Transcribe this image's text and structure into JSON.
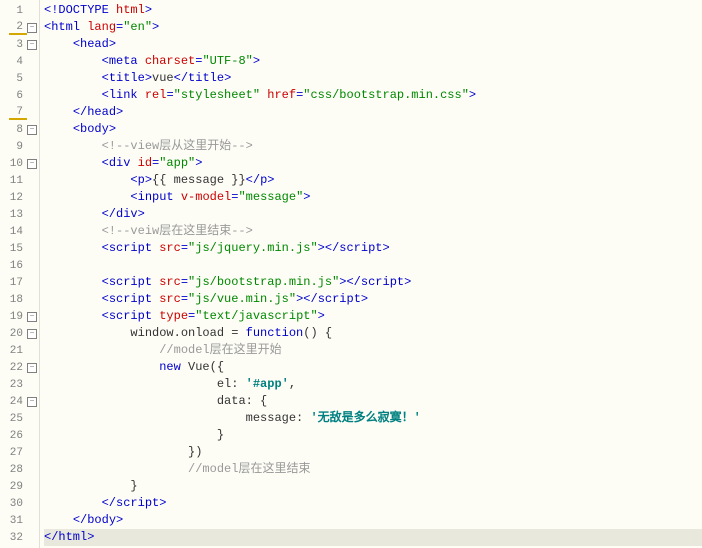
{
  "lines": [
    {
      "num": 1,
      "fold": "",
      "underline": false,
      "tokens": [
        {
          "c": "punct",
          "t": "<!"
        },
        {
          "c": "tag",
          "t": "DOCTYPE"
        },
        {
          "c": "text",
          "t": " "
        },
        {
          "c": "attr-name",
          "t": "html"
        },
        {
          "c": "punct",
          "t": ">"
        }
      ]
    },
    {
      "num": 2,
      "fold": "−",
      "underline": true,
      "tokens": [
        {
          "c": "punct",
          "t": "<"
        },
        {
          "c": "tag",
          "t": "html"
        },
        {
          "c": "text",
          "t": " "
        },
        {
          "c": "attr-name",
          "t": "lang"
        },
        {
          "c": "punct",
          "t": "="
        },
        {
          "c": "attr-val",
          "t": "\"en\""
        },
        {
          "c": "punct",
          "t": ">"
        }
      ]
    },
    {
      "num": 3,
      "fold": "−",
      "underline": false,
      "indent": 1,
      "tokens": [
        {
          "c": "punct",
          "t": "<"
        },
        {
          "c": "tag",
          "t": "head"
        },
        {
          "c": "punct",
          "t": ">"
        }
      ]
    },
    {
      "num": 4,
      "fold": "",
      "underline": false,
      "indent": 2,
      "tokens": [
        {
          "c": "punct",
          "t": "<"
        },
        {
          "c": "tag",
          "t": "meta"
        },
        {
          "c": "text",
          "t": " "
        },
        {
          "c": "attr-name",
          "t": "charset"
        },
        {
          "c": "punct",
          "t": "="
        },
        {
          "c": "attr-val",
          "t": "\"UTF-8\""
        },
        {
          "c": "punct",
          "t": ">"
        }
      ]
    },
    {
      "num": 5,
      "fold": "",
      "underline": false,
      "indent": 2,
      "tokens": [
        {
          "c": "punct",
          "t": "<"
        },
        {
          "c": "tag",
          "t": "title"
        },
        {
          "c": "punct",
          "t": ">"
        },
        {
          "c": "text",
          "t": "vue"
        },
        {
          "c": "punct",
          "t": "</"
        },
        {
          "c": "tag",
          "t": "title"
        },
        {
          "c": "punct",
          "t": ">"
        }
      ]
    },
    {
      "num": 6,
      "fold": "",
      "underline": false,
      "indent": 2,
      "tokens": [
        {
          "c": "punct",
          "t": "<"
        },
        {
          "c": "tag",
          "t": "link"
        },
        {
          "c": "text",
          "t": " "
        },
        {
          "c": "attr-name",
          "t": "rel"
        },
        {
          "c": "punct",
          "t": "="
        },
        {
          "c": "attr-val",
          "t": "\"stylesheet\""
        },
        {
          "c": "text",
          "t": " "
        },
        {
          "c": "attr-name",
          "t": "href"
        },
        {
          "c": "punct",
          "t": "="
        },
        {
          "c": "attr-val",
          "t": "\"css/bootstrap.min.css\""
        },
        {
          "c": "punct",
          "t": ">"
        }
      ]
    },
    {
      "num": 7,
      "fold": "",
      "underline": true,
      "indent": 1,
      "tokens": [
        {
          "c": "punct",
          "t": "</"
        },
        {
          "c": "tag",
          "t": "head"
        },
        {
          "c": "punct",
          "t": ">"
        }
      ]
    },
    {
      "num": 8,
      "fold": "−",
      "underline": false,
      "indent": 1,
      "tokens": [
        {
          "c": "punct",
          "t": "<"
        },
        {
          "c": "tag",
          "t": "body"
        },
        {
          "c": "punct",
          "t": ">"
        }
      ]
    },
    {
      "num": 9,
      "fold": "",
      "underline": false,
      "indent": 2,
      "tokens": [
        {
          "c": "comment",
          "t": "<!--view层从这里开始-->"
        }
      ]
    },
    {
      "num": 10,
      "fold": "−",
      "underline": false,
      "indent": 2,
      "tokens": [
        {
          "c": "punct",
          "t": "<"
        },
        {
          "c": "tag",
          "t": "div"
        },
        {
          "c": "text",
          "t": " "
        },
        {
          "c": "attr-name",
          "t": "id"
        },
        {
          "c": "punct",
          "t": "="
        },
        {
          "c": "attr-val",
          "t": "\"app\""
        },
        {
          "c": "punct",
          "t": ">"
        }
      ]
    },
    {
      "num": 11,
      "fold": "",
      "underline": false,
      "indent": 3,
      "tokens": [
        {
          "c": "punct",
          "t": "<"
        },
        {
          "c": "tag",
          "t": "p"
        },
        {
          "c": "punct",
          "t": ">"
        },
        {
          "c": "text",
          "t": "{{ message }}"
        },
        {
          "c": "punct",
          "t": "</"
        },
        {
          "c": "tag",
          "t": "p"
        },
        {
          "c": "punct",
          "t": ">"
        }
      ]
    },
    {
      "num": 12,
      "fold": "",
      "underline": false,
      "indent": 3,
      "tokens": [
        {
          "c": "punct",
          "t": "<"
        },
        {
          "c": "tag",
          "t": "input"
        },
        {
          "c": "text",
          "t": " "
        },
        {
          "c": "attr-name",
          "t": "v-model"
        },
        {
          "c": "punct",
          "t": "="
        },
        {
          "c": "attr-val",
          "t": "\"message\""
        },
        {
          "c": "punct",
          "t": ">"
        }
      ]
    },
    {
      "num": 13,
      "fold": "",
      "underline": false,
      "indent": 2,
      "tokens": [
        {
          "c": "punct",
          "t": "</"
        },
        {
          "c": "tag",
          "t": "div"
        },
        {
          "c": "punct",
          "t": ">"
        }
      ]
    },
    {
      "num": 14,
      "fold": "",
      "underline": false,
      "indent": 2,
      "tokens": [
        {
          "c": "comment",
          "t": "<!--veiw层在这里结束-->"
        }
      ]
    },
    {
      "num": 15,
      "fold": "",
      "underline": false,
      "indent": 2,
      "tokens": [
        {
          "c": "punct",
          "t": "<"
        },
        {
          "c": "tag",
          "t": "script"
        },
        {
          "c": "text",
          "t": " "
        },
        {
          "c": "attr-name",
          "t": "src"
        },
        {
          "c": "punct",
          "t": "="
        },
        {
          "c": "attr-val",
          "t": "\"js/jquery.min.js\""
        },
        {
          "c": "punct",
          "t": "></"
        },
        {
          "c": "tag",
          "t": "script"
        },
        {
          "c": "punct",
          "t": ">"
        }
      ]
    },
    {
      "num": 16,
      "fold": "",
      "underline": false,
      "indent": 0,
      "tokens": []
    },
    {
      "num": 17,
      "fold": "",
      "underline": false,
      "indent": 2,
      "tokens": [
        {
          "c": "punct",
          "t": "<"
        },
        {
          "c": "tag",
          "t": "script"
        },
        {
          "c": "text",
          "t": " "
        },
        {
          "c": "attr-name",
          "t": "src"
        },
        {
          "c": "punct",
          "t": "="
        },
        {
          "c": "attr-val",
          "t": "\"js/bootstrap.min.js\""
        },
        {
          "c": "punct",
          "t": "></"
        },
        {
          "c": "tag",
          "t": "script"
        },
        {
          "c": "punct",
          "t": ">"
        }
      ]
    },
    {
      "num": 18,
      "fold": "",
      "underline": false,
      "indent": 2,
      "tokens": [
        {
          "c": "punct",
          "t": "<"
        },
        {
          "c": "tag",
          "t": "script"
        },
        {
          "c": "text",
          "t": " "
        },
        {
          "c": "attr-name",
          "t": "src"
        },
        {
          "c": "punct",
          "t": "="
        },
        {
          "c": "attr-val",
          "t": "\"js/vue.min.js\""
        },
        {
          "c": "punct",
          "t": "></"
        },
        {
          "c": "tag",
          "t": "script"
        },
        {
          "c": "punct",
          "t": ">"
        }
      ]
    },
    {
      "num": 19,
      "fold": "−",
      "underline": false,
      "indent": 2,
      "tokens": [
        {
          "c": "punct",
          "t": "<"
        },
        {
          "c": "tag",
          "t": "script"
        },
        {
          "c": "text",
          "t": " "
        },
        {
          "c": "attr-name",
          "t": "type"
        },
        {
          "c": "punct",
          "t": "="
        },
        {
          "c": "attr-val",
          "t": "\"text/javascript\""
        },
        {
          "c": "punct",
          "t": ">"
        }
      ]
    },
    {
      "num": 20,
      "fold": "−",
      "underline": false,
      "indent": 3,
      "tokens": [
        {
          "c": "text",
          "t": "window.onload = "
        },
        {
          "c": "tag",
          "t": "function"
        },
        {
          "c": "text",
          "t": "() {"
        }
      ]
    },
    {
      "num": 21,
      "fold": "",
      "underline": false,
      "indent": 4,
      "tokens": [
        {
          "c": "comment",
          "t": "//model层在这里开始"
        }
      ]
    },
    {
      "num": 22,
      "fold": "−",
      "underline": false,
      "indent": 4,
      "tokens": [
        {
          "c": "tag",
          "t": "new"
        },
        {
          "c": "text",
          "t": " Vue({"
        }
      ]
    },
    {
      "num": 23,
      "fold": "",
      "underline": false,
      "indent": 5,
      "tokens": [
        {
          "c": "text",
          "t": "    el: "
        },
        {
          "c": "js-str",
          "t": "'#app'"
        },
        {
          "c": "text",
          "t": ","
        }
      ]
    },
    {
      "num": 24,
      "fold": "−",
      "underline": false,
      "indent": 5,
      "tokens": [
        {
          "c": "text",
          "t": "    data: {"
        }
      ]
    },
    {
      "num": 25,
      "fold": "",
      "underline": false,
      "indent": 6,
      "tokens": [
        {
          "c": "text",
          "t": "    message: "
        },
        {
          "c": "js-str",
          "t": "'无敌是多么寂寞！'"
        }
      ]
    },
    {
      "num": 26,
      "fold": "",
      "underline": false,
      "indent": 5,
      "tokens": [
        {
          "c": "text",
          "t": "    }"
        }
      ]
    },
    {
      "num": 27,
      "fold": "",
      "underline": false,
      "indent": 4,
      "tokens": [
        {
          "c": "text",
          "t": "    })"
        }
      ]
    },
    {
      "num": 28,
      "fold": "",
      "underline": false,
      "indent": 4,
      "tokens": [
        {
          "c": "text",
          "t": "    "
        },
        {
          "c": "comment",
          "t": "//model层在这里结束"
        }
      ]
    },
    {
      "num": 29,
      "fold": "",
      "underline": false,
      "indent": 3,
      "tokens": [
        {
          "c": "text",
          "t": "}"
        }
      ]
    },
    {
      "num": 30,
      "fold": "",
      "underline": false,
      "indent": 2,
      "tokens": [
        {
          "c": "punct",
          "t": "</"
        },
        {
          "c": "tag",
          "t": "script"
        },
        {
          "c": "punct",
          "t": ">"
        }
      ]
    },
    {
      "num": 31,
      "fold": "",
      "underline": false,
      "indent": 1,
      "tokens": [
        {
          "c": "punct",
          "t": "</"
        },
        {
          "c": "tag",
          "t": "body"
        },
        {
          "c": "punct",
          "t": ">"
        }
      ]
    },
    {
      "num": 32,
      "fold": "",
      "underline": false,
      "highlight": true,
      "indent": 0,
      "tokens": [
        {
          "c": "punct",
          "t": "</"
        },
        {
          "c": "tag",
          "t": "html"
        },
        {
          "c": "punct",
          "t": ">"
        }
      ]
    }
  ]
}
